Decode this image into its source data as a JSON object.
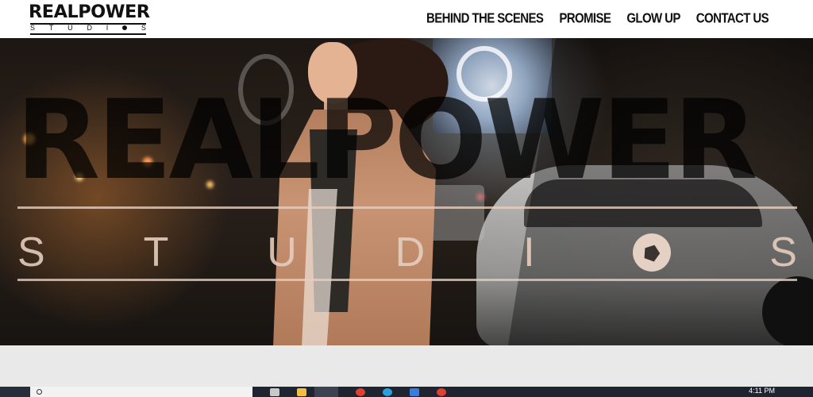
{
  "logo": {
    "name": "REALPOWER",
    "subtitle_letters": [
      "S",
      "T",
      "U",
      "D",
      "I",
      "O",
      "S"
    ]
  },
  "nav": {
    "items": [
      {
        "label": "BEHIND THE SCENES"
      },
      {
        "label": "PROMISE"
      },
      {
        "label": "GLOW UP"
      },
      {
        "label": "CONTACT US"
      }
    ]
  },
  "hero": {
    "big_word": "REALPOWER",
    "studios_letters": [
      "S",
      "T",
      "U",
      "D",
      "I",
      "O",
      "S"
    ]
  },
  "taskbar": {
    "clock": "4:11 PM"
  },
  "colors": {
    "header_bg": "#ffffff",
    "nav_text": "#111111",
    "hero_overlay_text": "#e6cdbe",
    "grey_band": "#e9e9e9",
    "taskbar": "#1f2430"
  }
}
